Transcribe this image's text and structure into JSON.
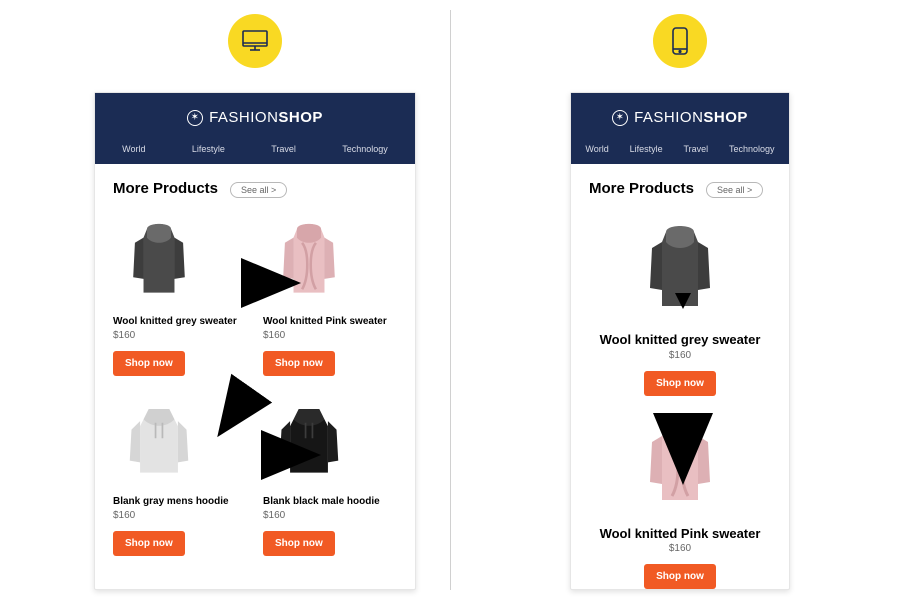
{
  "brand": {
    "prefix": "FASHION",
    "suffix": "SHOP"
  },
  "nav": [
    "World",
    "Lifestyle",
    "Travel",
    "Technology"
  ],
  "section_title": "More Products",
  "see_all": "See all >",
  "cta": "Shop now",
  "colors": {
    "header_bg": "#1b2c54",
    "cta_bg": "#f15a24",
    "badge_bg": "#f9d923",
    "arrow": "#1a36e8"
  },
  "reading_order": {
    "desktop_grid": "Z-pattern across 2x2 grid",
    "mobile_list": "top-to-bottom single column"
  },
  "products": [
    {
      "name": "Wool knitted grey sweater",
      "price": "$160",
      "image": "grey-turtleneck-sweater"
    },
    {
      "name": "Wool knitted Pink sweater",
      "price": "$160",
      "image": "pink-cable-knit-sweater"
    },
    {
      "name": "Blank gray mens hoodie",
      "price": "$160",
      "image": "gray-hoodie"
    },
    {
      "name": "Blank black male hoodie",
      "price": "$160",
      "image": "black-hoodie"
    }
  ]
}
